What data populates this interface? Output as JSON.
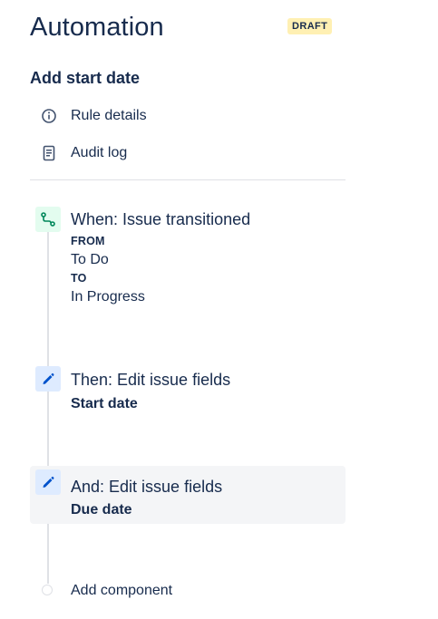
{
  "header": {
    "title": "Automation",
    "badge": "DRAFT"
  },
  "rule": {
    "name": "Add start date"
  },
  "menu": [
    {
      "label": "Rule details",
      "icon": "info-icon"
    },
    {
      "label": "Audit log",
      "icon": "document-icon"
    }
  ],
  "steps": {
    "trigger": {
      "title": "When: Issue transitioned",
      "from_caption": "FROM",
      "from_value": "To Do",
      "to_caption": "TO",
      "to_value": "In Progress",
      "icon": "transition-icon",
      "icon_bg": "#e3fcef",
      "icon_color": "#00875a"
    },
    "action1": {
      "title": "Then: Edit issue fields",
      "subtitle": "Start date",
      "icon": "pencil-icon",
      "icon_bg": "#deebff",
      "icon_color": "#0052cc"
    },
    "action2": {
      "title": "And: Edit issue fields",
      "subtitle": "Due date",
      "icon": "pencil-icon",
      "icon_bg": "#deebff",
      "icon_color": "#0052cc",
      "selected": true
    }
  },
  "add_component": {
    "label": "Add component"
  },
  "colors": {
    "text": "#172b4d",
    "badge_bg": "#fff0b3",
    "divider": "#dfe1e6",
    "selected_bg": "#f4f5f7"
  }
}
